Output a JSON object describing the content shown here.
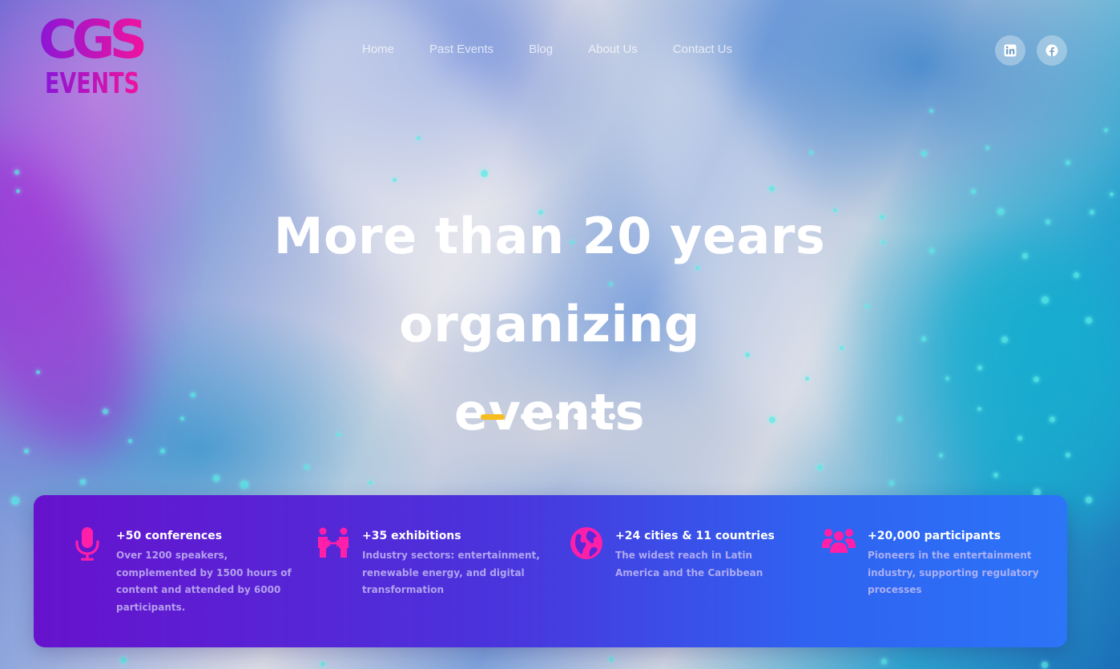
{
  "brand": {
    "logo_top": "CGS",
    "logo_bottom": "EVENTS",
    "colors": {
      "purple": "#8a16d6",
      "magenta": "#f0139e"
    }
  },
  "nav": {
    "items": [
      {
        "label": "Home",
        "active": true
      },
      {
        "label": "Past Events",
        "active": false
      },
      {
        "label": "Blog",
        "active": false
      },
      {
        "label": "About Us",
        "active": false
      },
      {
        "label": "Contact Us",
        "active": false
      }
    ],
    "active_underline_color": "#f3c24a"
  },
  "social": [
    {
      "icon": "linkedin-icon"
    },
    {
      "icon": "facebook-icon"
    }
  ],
  "hero": {
    "title_line1": "More than 20 years organizing",
    "title_line2": "events"
  },
  "slider": {
    "slide_count": 7,
    "active_index": 0,
    "active_color": "#f5bd1f"
  },
  "stats": [
    {
      "icon": "microphone-icon",
      "title": "+50 conferences",
      "description": "Over 1200 speakers, complemented by 1500 hours of content and attended by 6000 participants."
    },
    {
      "icon": "exhibition-people-icon",
      "title": "+35 exhibitions",
      "description": "Industry sectors: entertainment, renewable energy, and digital transformation"
    },
    {
      "icon": "globe-icon",
      "title": "+24 cities & 11 countries",
      "description": "The widest reach in Latin America and the Caribbean"
    },
    {
      "icon": "participants-group-icon",
      "title": "+20,000 participants",
      "description": "Pioneers in the entertainment industry, supporting regulatory processes"
    }
  ],
  "stats_icon_color": "#ff1fa8"
}
